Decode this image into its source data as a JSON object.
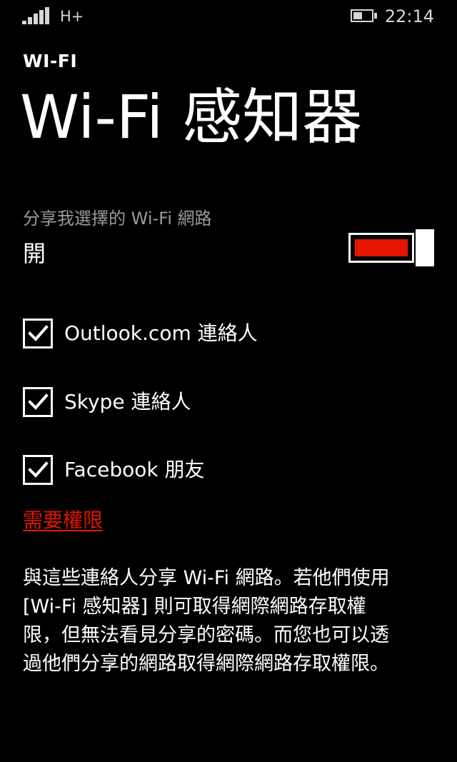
{
  "status_bar": {
    "signal_icon": "signal-strength-icon",
    "network_type": "H+",
    "battery_icon": "battery-icon",
    "battery_level": 0.3,
    "time": "22:14"
  },
  "header": {
    "app_title": "WI-FI",
    "page_title": "Wi-Fi 感知器"
  },
  "sharing": {
    "label": "分享我選擇的 Wi-Fi 網路",
    "state": "開",
    "toggle_on": true,
    "accent_color": "#e51400"
  },
  "contacts": [
    {
      "label": "Outlook.com 連絡人",
      "checked": true
    },
    {
      "label": "Skype 連絡人",
      "checked": true
    },
    {
      "label": "Facebook 朋友",
      "checked": true
    }
  ],
  "permission_link": "需要權限",
  "description_lines": [
    "與這些連絡人分享 Wi-Fi 網路。若他們使用",
    "[Wi-Fi 感知器] 則可取得網際網路存取權",
    "限，但無法看見分享的密碼。而您也可以透",
    "過他們分享的網路取得網際網路存取權限。"
  ]
}
